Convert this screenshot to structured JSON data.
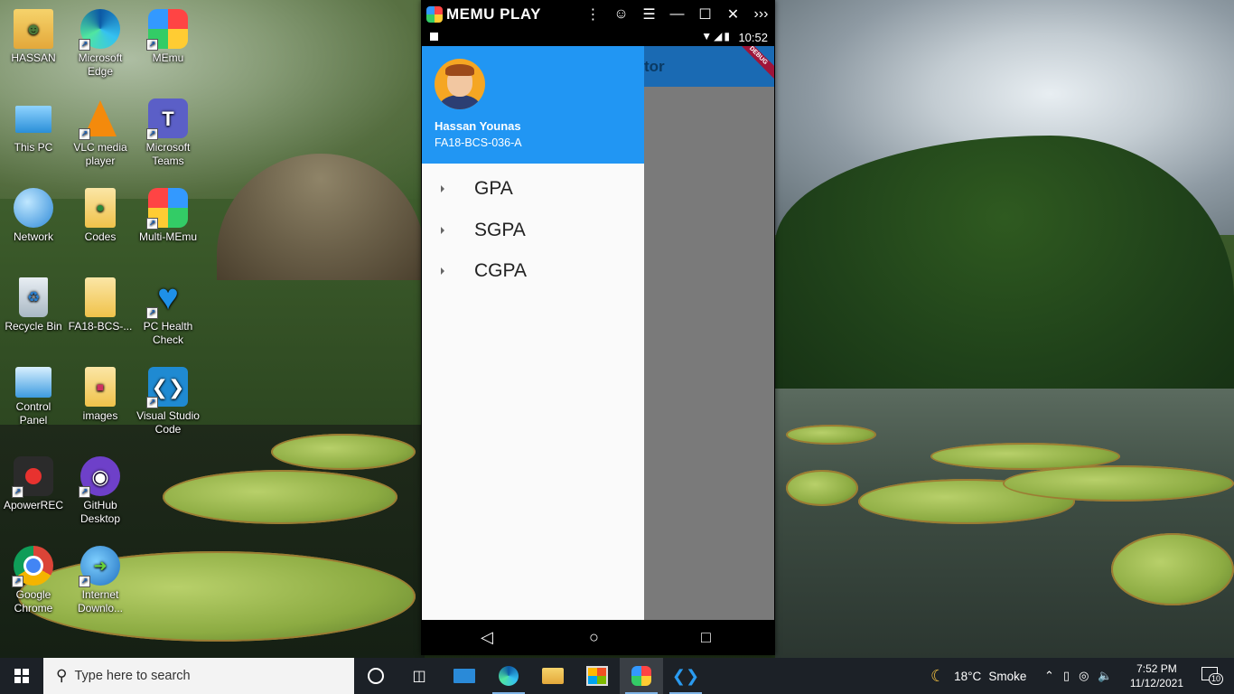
{
  "desktop": {
    "icons": [
      {
        "label": "HASSAN"
      },
      {
        "label": "Microsoft Edge"
      },
      {
        "label": "MEmu"
      },
      {
        "label": "This PC"
      },
      {
        "label": "VLC media player"
      },
      {
        "label": "Microsoft Teams"
      },
      {
        "label": "Network"
      },
      {
        "label": "Codes"
      },
      {
        "label": "Multi-MEmu"
      },
      {
        "label": "Recycle Bin"
      },
      {
        "label": "FA18-BCS-..."
      },
      {
        "label": "PC Health Check"
      },
      {
        "label": "Control Panel"
      },
      {
        "label": "images"
      },
      {
        "label": "Visual Studio Code"
      },
      {
        "label": "ApowerREC"
      },
      {
        "label": "GitHub Desktop"
      },
      {
        "label": "Google Chrome"
      },
      {
        "label": "Internet Downlo..."
      }
    ]
  },
  "emulator": {
    "title": "MEMU PLAY",
    "status_time": "10:52",
    "app_title_partial": "tor",
    "debug_badge": "DEBUG",
    "drawer": {
      "user_name": "Hassan Younas",
      "user_id": "FA18-BCS-036-A",
      "items": [
        {
          "label": "GPA"
        },
        {
          "label": "SGPA"
        },
        {
          "label": "CGPA"
        }
      ]
    }
  },
  "taskbar": {
    "search_placeholder": "Type here to search",
    "weather_temp": "18°C",
    "weather_desc": "Smoke",
    "time": "7:52 PM",
    "date": "11/12/2021",
    "notification_count": "10"
  },
  "colors": {
    "drawer_header": "#2196f3",
    "app_bar": "#1a6ab3",
    "taskbar": "#1c2127"
  }
}
